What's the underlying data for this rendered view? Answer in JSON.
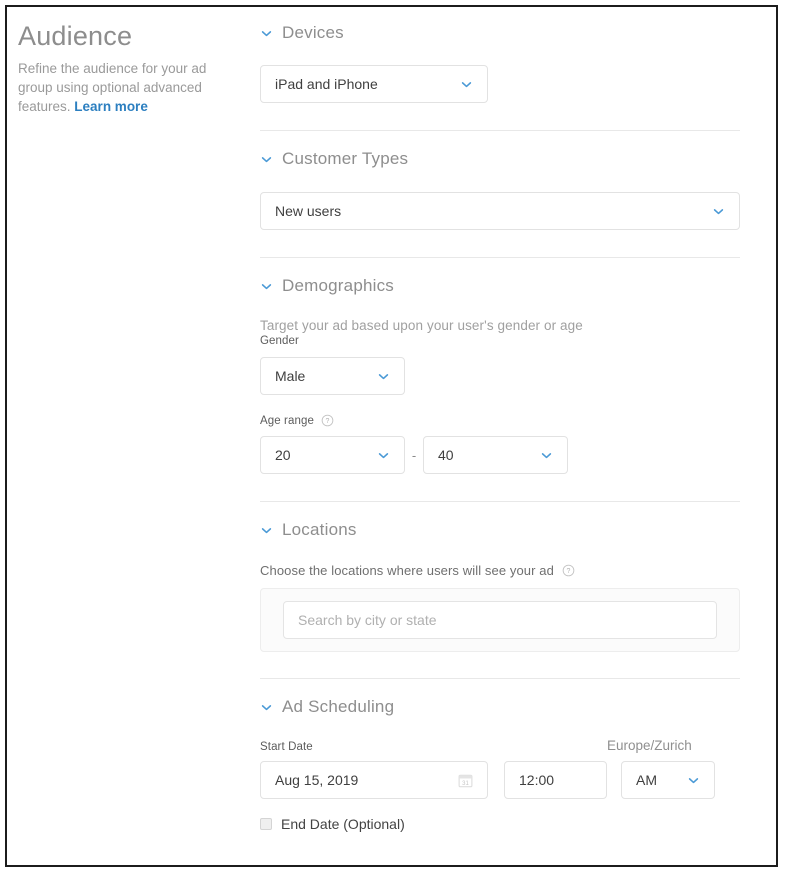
{
  "left": {
    "title": "Audience",
    "description": "Refine the audience for your ad group using optional advanced features.",
    "learn_more": "Learn more"
  },
  "colors": {
    "accent": "#2c7fc0",
    "chevron": "#4b9ad6",
    "heading": "#8e8e8e",
    "border": "#e2e2e2",
    "frame": "#1c1c1c"
  },
  "sections": {
    "devices": {
      "title": "Devices",
      "toggle_icon": "chevron-down-icon",
      "value": "iPad and iPhone"
    },
    "customer_types": {
      "title": "Customer Types",
      "toggle_icon": "chevron-down-icon",
      "value": "New users"
    },
    "demographics": {
      "title": "Demographics",
      "toggle_icon": "chevron-down-icon",
      "description": "Target your ad based upon your user's gender or age",
      "gender_label": "Gender",
      "gender_value": "Male",
      "age_label": "Age range",
      "age_help_icon": "help-circle-icon",
      "age_min": "20",
      "age_separator": "-",
      "age_max": "40"
    },
    "locations": {
      "title": "Locations",
      "toggle_icon": "chevron-down-icon",
      "description": "Choose the locations where users will see your ad",
      "help_icon": "help-circle-icon",
      "search_placeholder": "Search by city or state",
      "search_value": ""
    },
    "ad_scheduling": {
      "title": "Ad Scheduling",
      "toggle_icon": "chevron-down-icon",
      "start_date_label": "Start Date",
      "start_date_value": "Aug 15, 2019",
      "calendar_icon": "calendar-icon",
      "calendar_icon_day": "31",
      "time_value": "12:00",
      "meridiem_value": "AM",
      "timezone": "Europe/Zurich",
      "end_date_label": "End Date (Optional)",
      "end_date_checked": false
    }
  }
}
